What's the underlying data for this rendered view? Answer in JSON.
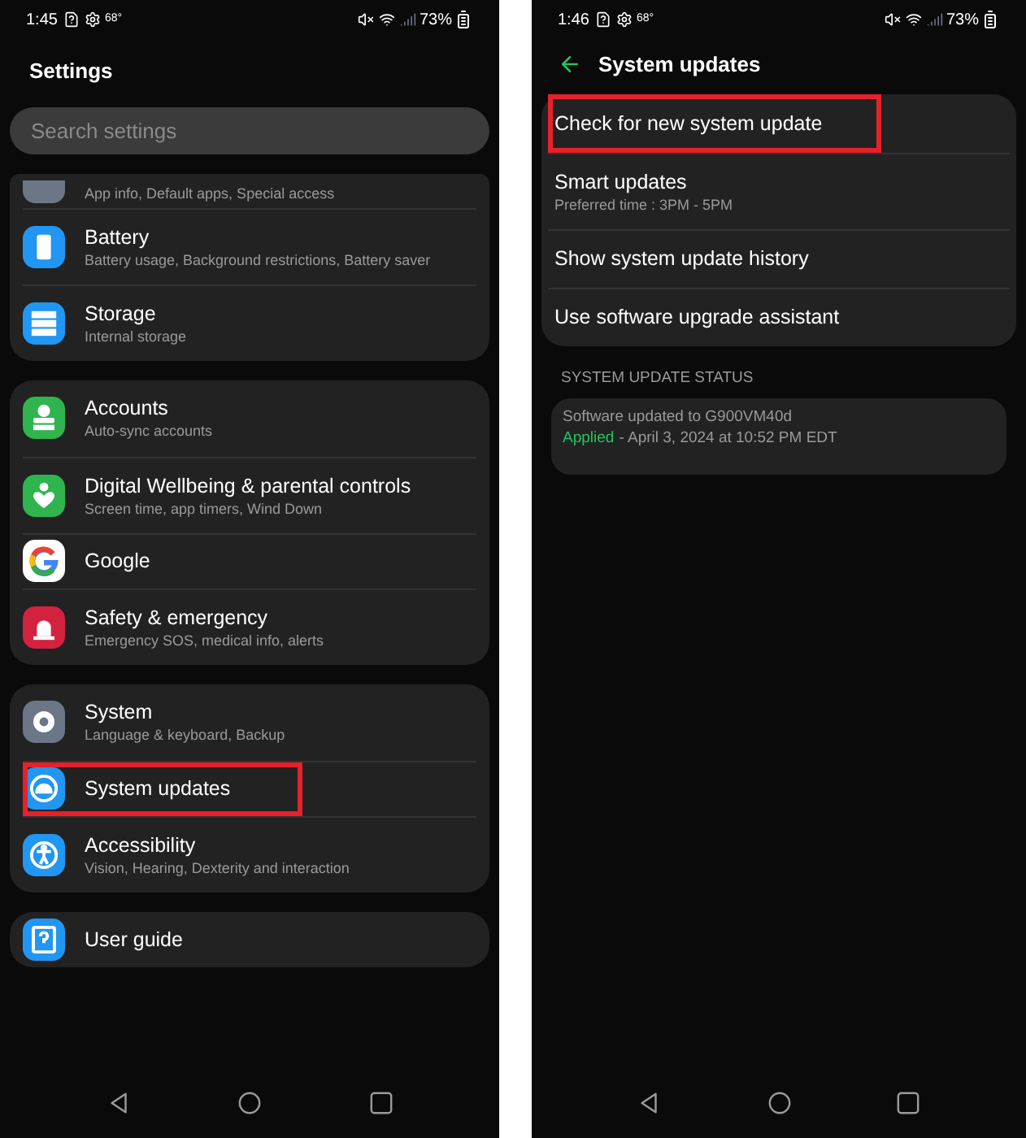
{
  "screens": [
    {
      "status_bar": {
        "time": "1:45",
        "temperature": "68°",
        "battery": "73%"
      },
      "title": "Settings",
      "search": {
        "placeholder": "Search settings"
      },
      "groups": [
        {
          "items": [
            {
              "subtitle": "App info, Default apps, Special access",
              "color": "#6b7686",
              "highlighted": false
            },
            {
              "title": "Battery",
              "subtitle": "Battery usage, Background restrictions, Battery saver",
              "color": "#2196f3",
              "highlighted": false
            },
            {
              "title": "Storage",
              "subtitle": "Internal storage",
              "color": "#2196f3",
              "highlighted": false
            }
          ]
        },
        {
          "items": [
            {
              "title": "Accounts",
              "subtitle": "Auto-sync accounts",
              "color": "#2fb44e",
              "highlighted": false
            },
            {
              "title": "Digital Wellbeing & parental controls",
              "subtitle": "Screen time, app timers, Wind Down",
              "color": "#2fb44e",
              "highlighted": false
            },
            {
              "title": "Google",
              "color": "#ffffff",
              "highlighted": false
            },
            {
              "title": "Safety & emergency",
              "subtitle": "Emergency SOS, medical info, alerts",
              "color": "#d32240",
              "highlighted": false
            }
          ]
        },
        {
          "items": [
            {
              "title": "System",
              "subtitle": "Language & keyboard, Backup",
              "color": "#6b7686",
              "highlighted": false
            },
            {
              "title": "System updates",
              "color": "#2196f3",
              "highlighted": true
            },
            {
              "title": "Accessibility",
              "subtitle": "Vision, Hearing, Dexterity and interaction",
              "color": "#2196f3",
              "highlighted": false
            }
          ]
        },
        {
          "items": [
            {
              "title": "User guide",
              "color": "#2196f3",
              "highlighted": false
            }
          ]
        }
      ]
    },
    {
      "status_bar": {
        "time": "1:46",
        "temperature": "68°",
        "battery": "73%"
      },
      "title": "System updates",
      "groups": [
        {
          "items": [
            {
              "title": "Check for new system update",
              "highlighted": true
            },
            {
              "title": "Smart updates",
              "subtitle": "Preferred time : 3PM - 5PM",
              "highlighted": false
            },
            {
              "title": "Show system update history",
              "highlighted": false
            },
            {
              "title": "Use software upgrade assistant",
              "highlighted": false
            }
          ]
        }
      ],
      "section_header": "SYSTEM UPDATE STATUS",
      "status_card": {
        "text": "Software updated to G900VM40d",
        "state": "Applied",
        "detail": "- April 3, 2024 at 10:52 PM EDT"
      }
    }
  ]
}
